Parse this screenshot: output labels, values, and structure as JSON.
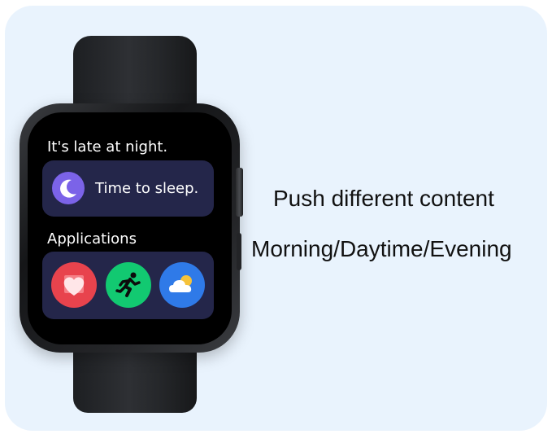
{
  "watch": {
    "greeting": "It's late at night.",
    "sleep_prompt": "Time to sleep.",
    "applications_label": "Applications",
    "icons": [
      "moon-icon",
      "heart-icon",
      "running-icon",
      "weather-icon"
    ]
  },
  "promo": {
    "headline": "Push different content",
    "subline": "Morning/Daytime/Evening"
  },
  "colors": {
    "background": "#e9f3fd",
    "watch_body": "#1d1f22",
    "card_bg": "#24264a",
    "moon": "#7b63e8",
    "heart_app": "#e8434d",
    "run_app": "#12c971",
    "weather_app": "#2f7ae8"
  }
}
